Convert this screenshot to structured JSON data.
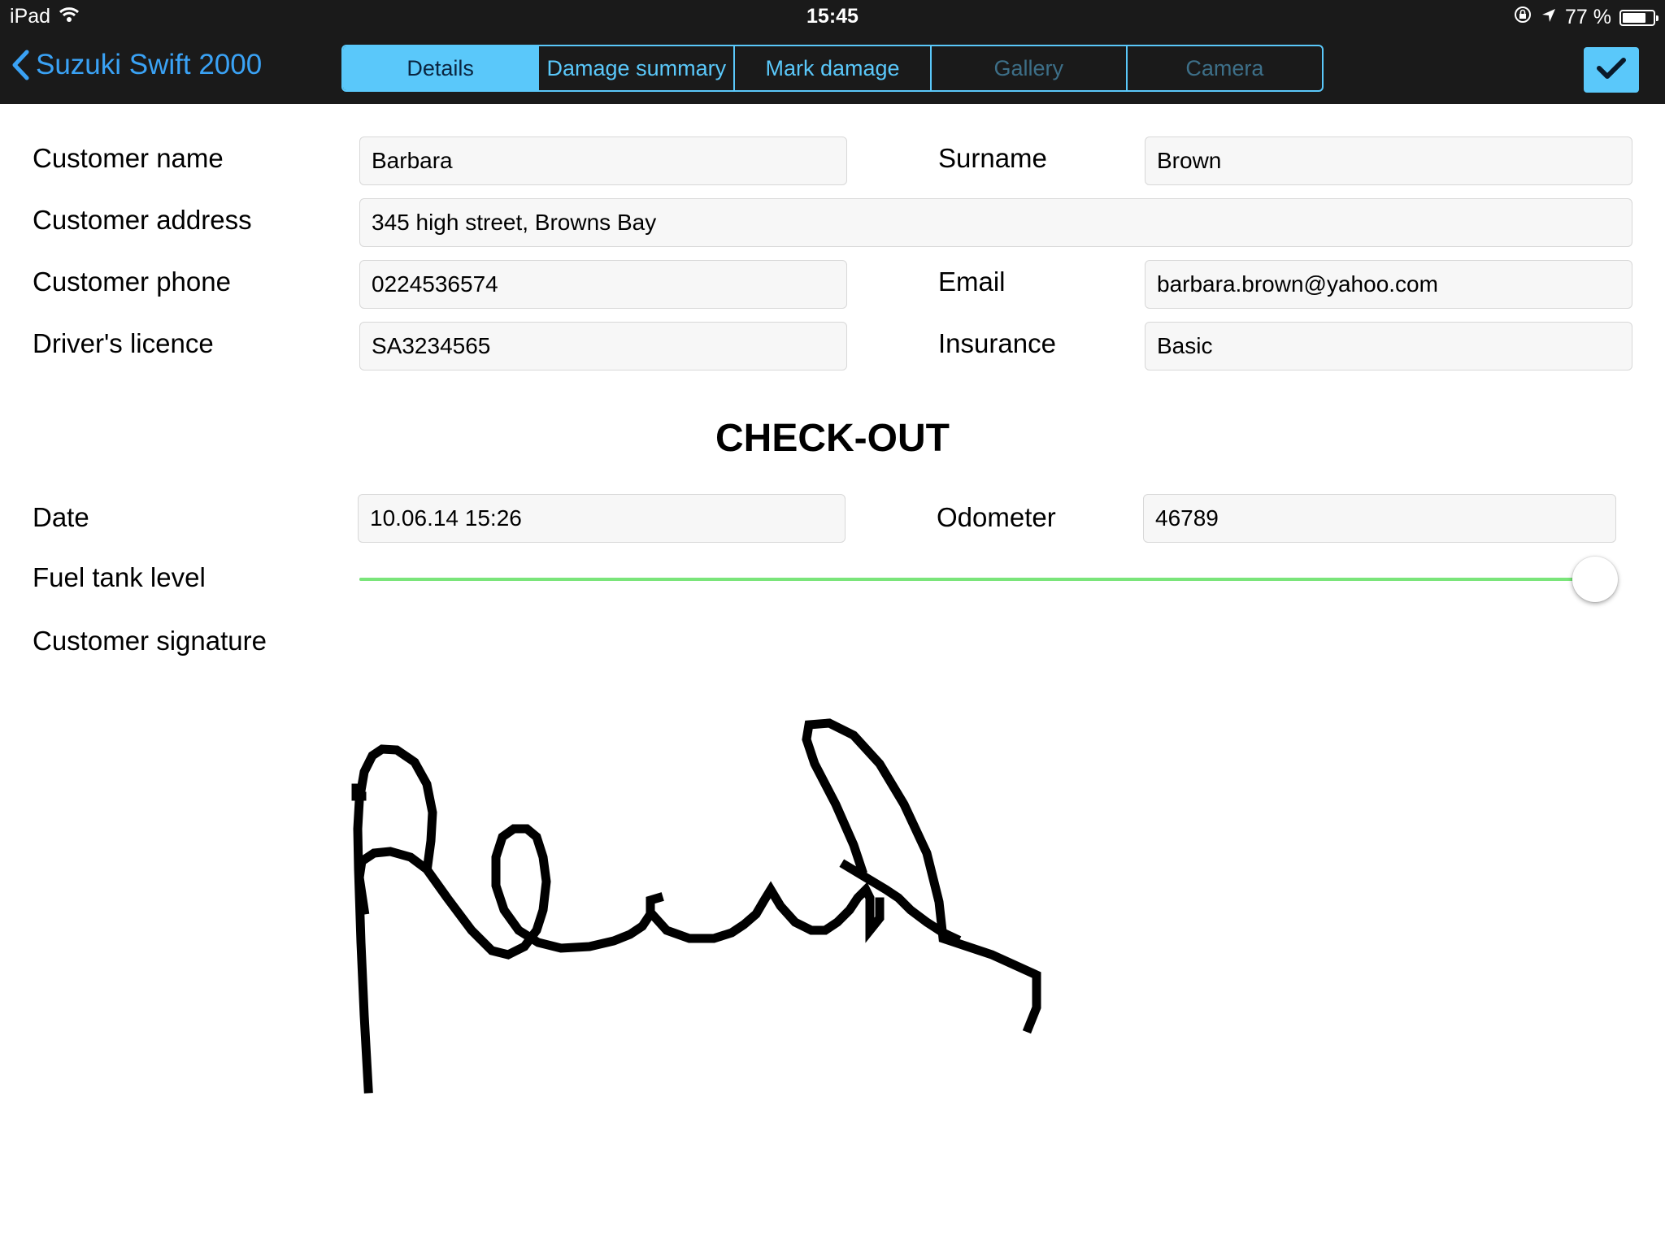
{
  "status_bar": {
    "device": "iPad",
    "time": "15:45",
    "battery_text": "77 %",
    "battery_level": 0.77
  },
  "nav": {
    "back_label": "Suzuki Swift 2000",
    "tabs": [
      {
        "label": "Details",
        "state": "active"
      },
      {
        "label": "Damage summary",
        "state": "normal"
      },
      {
        "label": "Mark damage",
        "state": "normal"
      },
      {
        "label": "Gallery",
        "state": "disabled"
      },
      {
        "label": "Camera",
        "state": "disabled"
      }
    ],
    "done_icon": "checkmark-icon"
  },
  "customer": {
    "name_label": "Customer name",
    "name_value": "Barbara",
    "surname_label": "Surname",
    "surname_value": "Brown",
    "address_label": "Customer address",
    "address_value": "345 high street, Browns Bay",
    "phone_label": "Customer phone",
    "phone_value": "0224536574",
    "email_label": "Email",
    "email_value": "barbara.brown@yahoo.com",
    "licence_label": "Driver's licence",
    "licence_value": "SA3234565",
    "insurance_label": "Insurance",
    "insurance_value": "Basic"
  },
  "checkout": {
    "title": "CHECK-OUT",
    "date_label": "Date",
    "date_value": "10.06.14 15:26",
    "odometer_label": "Odometer",
    "odometer_value": "46789",
    "fuel_label": "Fuel tank level",
    "fuel_level": 1.0,
    "signature_label": "Customer signature"
  },
  "colors": {
    "accent": "#5ac8fa",
    "back_link": "#3aa2f5",
    "bar_background": "#1a1a1a",
    "slider_fill": "#7ae57a"
  }
}
